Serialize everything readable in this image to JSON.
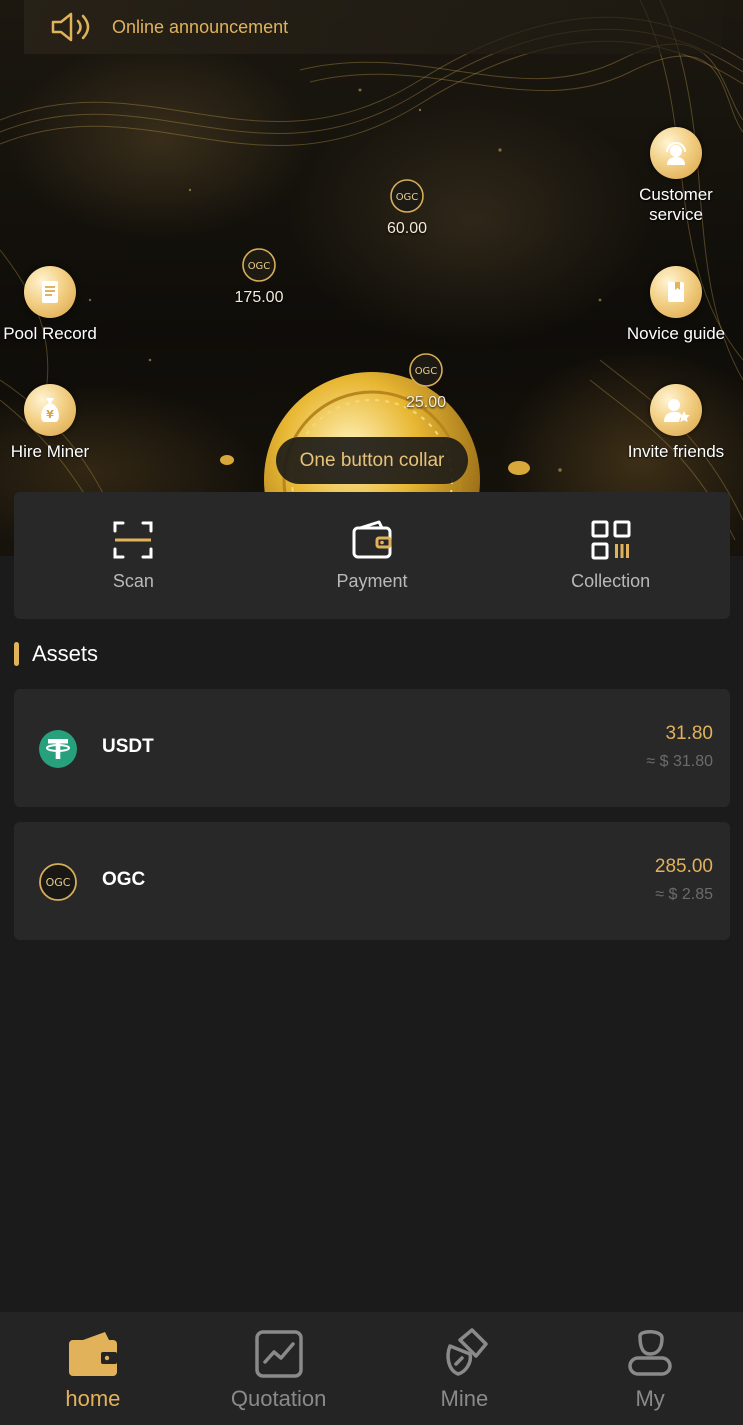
{
  "announcement": {
    "text": "Online announcement"
  },
  "hero": {
    "left_buttons": [
      {
        "id": "pool-record",
        "label": "Pool Record",
        "icon": "document-icon"
      },
      {
        "id": "hire-miner",
        "label": "Hire Miner",
        "icon": "money-bag-icon"
      }
    ],
    "right_buttons": [
      {
        "id": "customer-service",
        "label": "Customer\nservice",
        "icon": "headset-icon"
      },
      {
        "id": "novice-guide",
        "label": "Novice guide",
        "icon": "book-icon"
      },
      {
        "id": "invite-friends",
        "label": "Invite friends",
        "icon": "add-user-icon"
      }
    ],
    "floating_coins": [
      {
        "symbol": "OGC",
        "value": "60.00"
      },
      {
        "symbol": "OGC",
        "value": "175.00"
      },
      {
        "symbol": "OGC",
        "value": "25.00"
      }
    ],
    "collect_button": "One button collar"
  },
  "actions": [
    {
      "label": "Scan",
      "icon": "scan-icon"
    },
    {
      "label": "Payment",
      "icon": "wallet-icon"
    },
    {
      "label": "Collection",
      "icon": "qr-code-icon"
    }
  ],
  "assets": {
    "title": "Assets",
    "items": [
      {
        "name": "USDT",
        "amount": "31.80",
        "usd": "≈ $ 31.80",
        "icon": "tether-icon",
        "color": "#26a17b"
      },
      {
        "name": "OGC",
        "amount": "285.00",
        "usd": "≈ $ 2.85",
        "icon": "ogc-icon"
      }
    ]
  },
  "nav": {
    "items": [
      {
        "label": "home",
        "icon": "wallet-icon",
        "active": true
      },
      {
        "label": "Quotation",
        "icon": "chart-icon",
        "active": false
      },
      {
        "label": "Mine",
        "icon": "pickaxe-icon",
        "active": false
      },
      {
        "label": "My",
        "icon": "user-icon",
        "active": false
      }
    ]
  },
  "colors": {
    "accent": "#e2b25a",
    "card": "#282828",
    "background": "#1b1b1b"
  }
}
